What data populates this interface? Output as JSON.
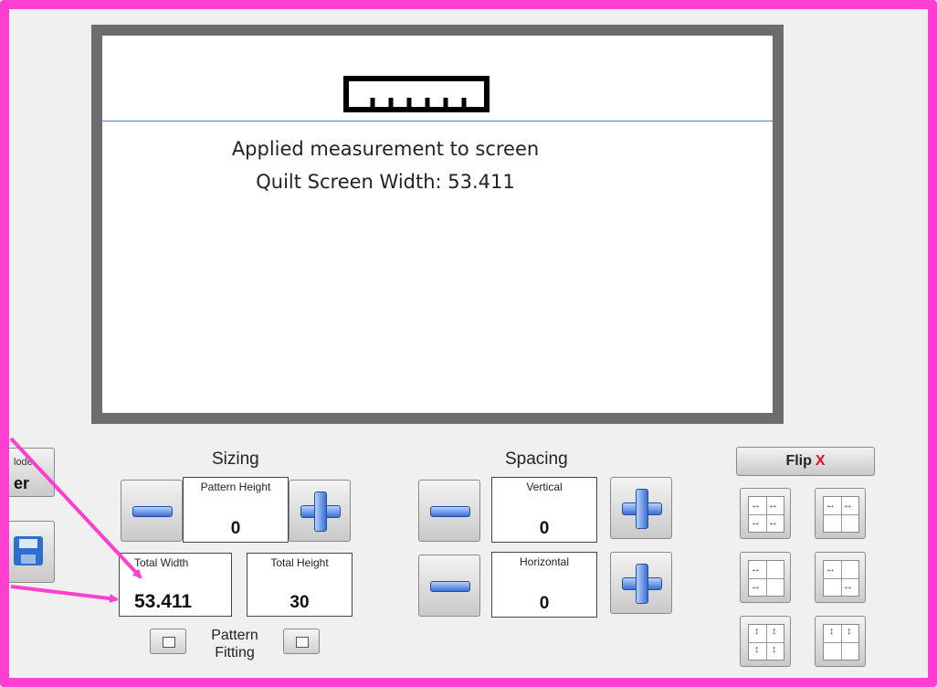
{
  "message": {
    "line1": "Applied measurement to screen",
    "line2": "Quilt Screen Width:  53.411"
  },
  "left": {
    "mode_label_partial": "lode",
    "mode_value_partial": "er"
  },
  "sizing": {
    "title": "Sizing",
    "pattern_height": {
      "label": "Pattern Height",
      "value": "0"
    },
    "total_width": {
      "label": "Total Width",
      "value": "53.411"
    },
    "total_height": {
      "label": "Total Height",
      "value": "30"
    },
    "fitting_label_line1": "Pattern",
    "fitting_label_line2": "Fitting"
  },
  "spacing": {
    "title": "Spacing",
    "vertical": {
      "label": "Vertical",
      "value": "0"
    },
    "horizontal": {
      "label": "Horizontal",
      "value": "0"
    }
  },
  "flip": {
    "label": "Flip",
    "x_mark": "X"
  },
  "colors": {
    "frame": "#ff3fcf",
    "accent_blue": "#3b6fd0",
    "flip_x": "#e0141d"
  },
  "icons": [
    "ruler-icon",
    "minus-icon",
    "plus-icon",
    "floppy-disk-icon",
    "layout-grid-icon"
  ]
}
